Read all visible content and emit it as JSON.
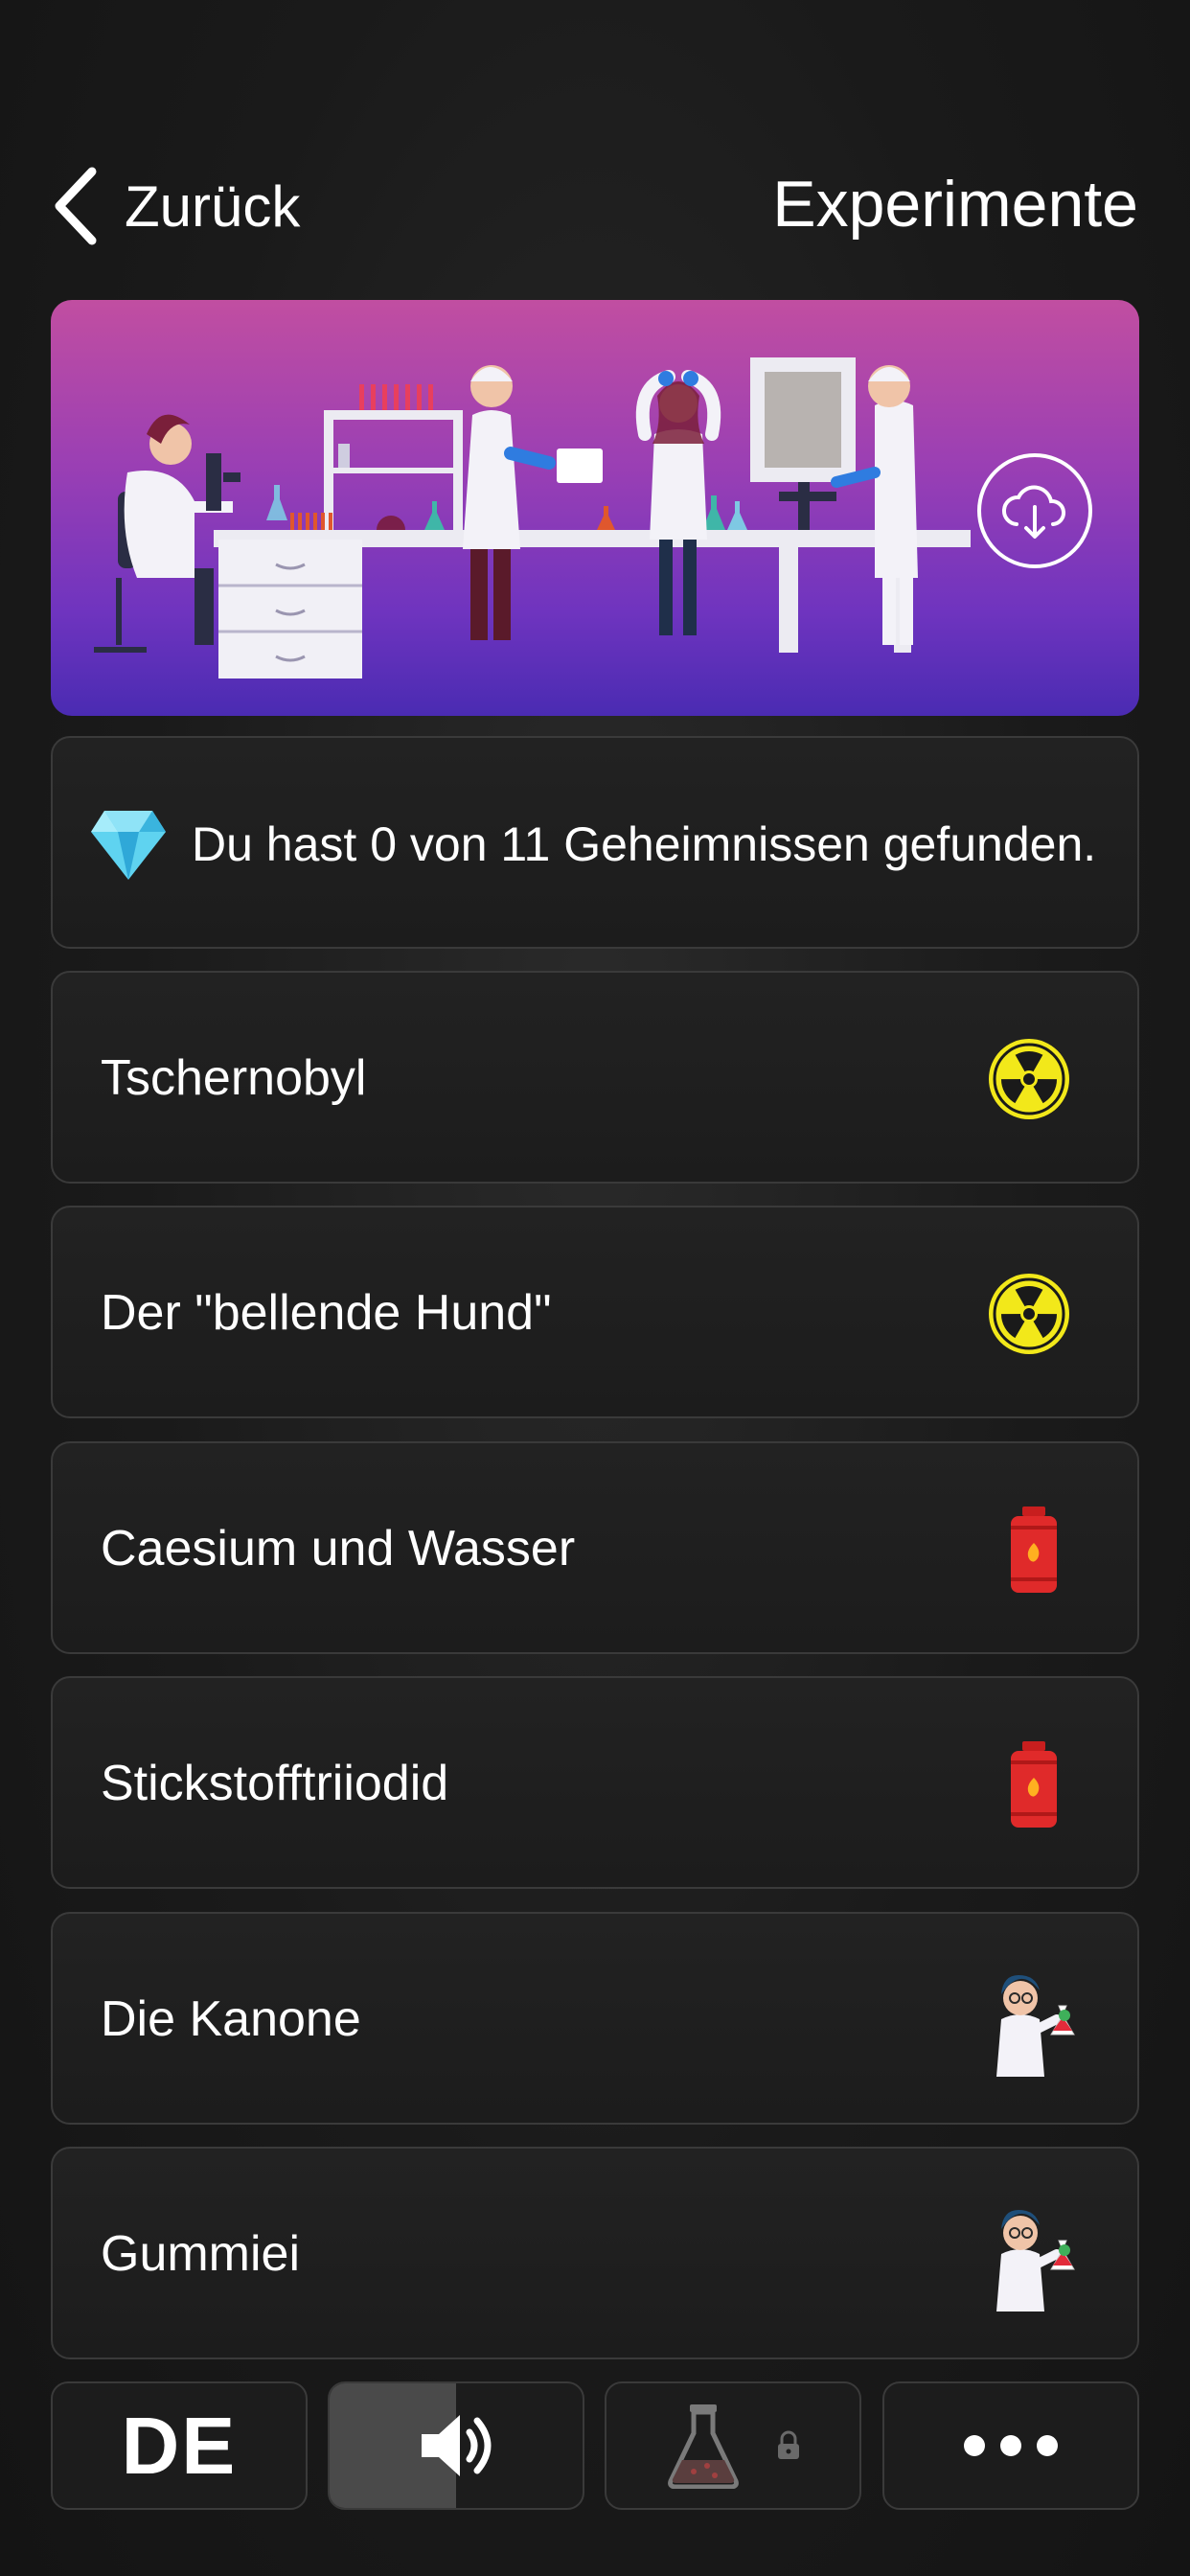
{
  "header": {
    "back_label": "Zurück",
    "title": "Experimente"
  },
  "secrets": {
    "text": "Du hast 0 von 11 Geheimnissen gefunden."
  },
  "experiments": [
    {
      "label": "Tschernobyl",
      "icon": "radioactive-icon"
    },
    {
      "label": "Der \"bellende Hund\"",
      "icon": "radioactive-icon"
    },
    {
      "label": "Caesium und Wasser",
      "icon": "gas-cylinder-icon"
    },
    {
      "label": "Stickstofftriiodid",
      "icon": "gas-cylinder-icon"
    },
    {
      "label": "Die Kanone",
      "icon": "scientist-icon"
    },
    {
      "label": "Gummiei",
      "icon": "scientist-icon"
    }
  ],
  "bottom_bar": {
    "language": "DE",
    "sound_level": 0.5
  },
  "colors": {
    "banner_top": "#c14ea1",
    "banner_bottom": "#4a2bb2",
    "radioactive": "#f2e81a",
    "cylinder": "#e02a2a"
  }
}
